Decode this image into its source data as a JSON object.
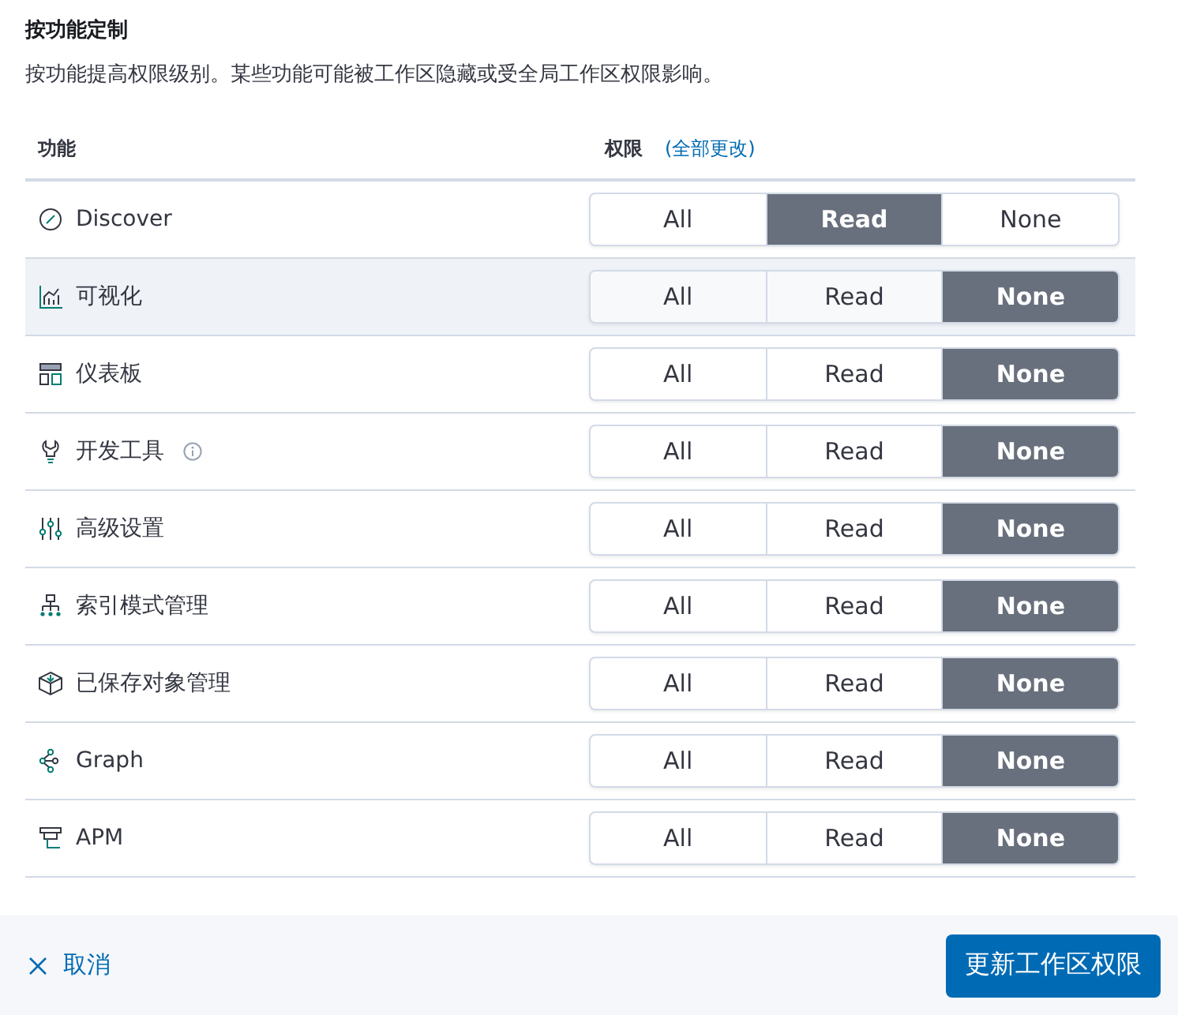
{
  "title": "按功能定制",
  "description": "按功能提高权限级别。某些功能可能被工作区隐藏或受全局工作区权限影响。",
  "table": {
    "columns": [
      {
        "label": "功能"
      },
      {
        "label": "权限",
        "link": "(全部更改)"
      }
    ],
    "rows": [
      {
        "kind": "compass",
        "label": "Discover",
        "info": false,
        "hovered": false,
        "options": [
          {
            "label": "All",
            "selected": false
          },
          {
            "label": "Read",
            "selected": true
          },
          {
            "label": "None",
            "selected": false
          }
        ]
      },
      {
        "kind": "chart",
        "label": "可视化",
        "info": false,
        "hovered": true,
        "options": [
          {
            "label": "All",
            "selected": false
          },
          {
            "label": "Read",
            "selected": false
          },
          {
            "label": "None",
            "selected": true
          }
        ]
      },
      {
        "kind": "dashboard",
        "label": "仪表板",
        "info": false,
        "hovered": false,
        "options": [
          {
            "label": "All",
            "selected": false
          },
          {
            "label": "Read",
            "selected": false
          },
          {
            "label": "None",
            "selected": true
          }
        ]
      },
      {
        "kind": "wrench",
        "label": "开发工具",
        "info": true,
        "hovered": false,
        "options": [
          {
            "label": "All",
            "selected": false
          },
          {
            "label": "Read",
            "selected": false
          },
          {
            "label": "None",
            "selected": true
          }
        ]
      },
      {
        "kind": "sliders",
        "label": "高级设置",
        "info": false,
        "hovered": false,
        "options": [
          {
            "label": "All",
            "selected": false
          },
          {
            "label": "Read",
            "selected": false
          },
          {
            "label": "None",
            "selected": true
          }
        ]
      },
      {
        "kind": "hierarchy",
        "label": "索引模式管理",
        "info": false,
        "hovered": false,
        "options": [
          {
            "label": "All",
            "selected": false
          },
          {
            "label": "Read",
            "selected": false
          },
          {
            "label": "None",
            "selected": true
          }
        ]
      },
      {
        "kind": "box",
        "label": "已保存对象管理",
        "info": false,
        "hovered": false,
        "options": [
          {
            "label": "All",
            "selected": false
          },
          {
            "label": "Read",
            "selected": false
          },
          {
            "label": "None",
            "selected": true
          }
        ]
      },
      {
        "kind": "graph",
        "label": "Graph",
        "info": false,
        "hovered": false,
        "options": [
          {
            "label": "All",
            "selected": false
          },
          {
            "label": "Read",
            "selected": false
          },
          {
            "label": "None",
            "selected": true
          }
        ]
      },
      {
        "kind": "apm",
        "label": "APM",
        "info": false,
        "hovered": false,
        "options": [
          {
            "label": "All",
            "selected": false
          },
          {
            "label": "Read",
            "selected": false
          },
          {
            "label": "None",
            "selected": true
          }
        ]
      }
    ]
  },
  "footer": {
    "cancel": "取消",
    "submit": "更新工作区权限"
  }
}
